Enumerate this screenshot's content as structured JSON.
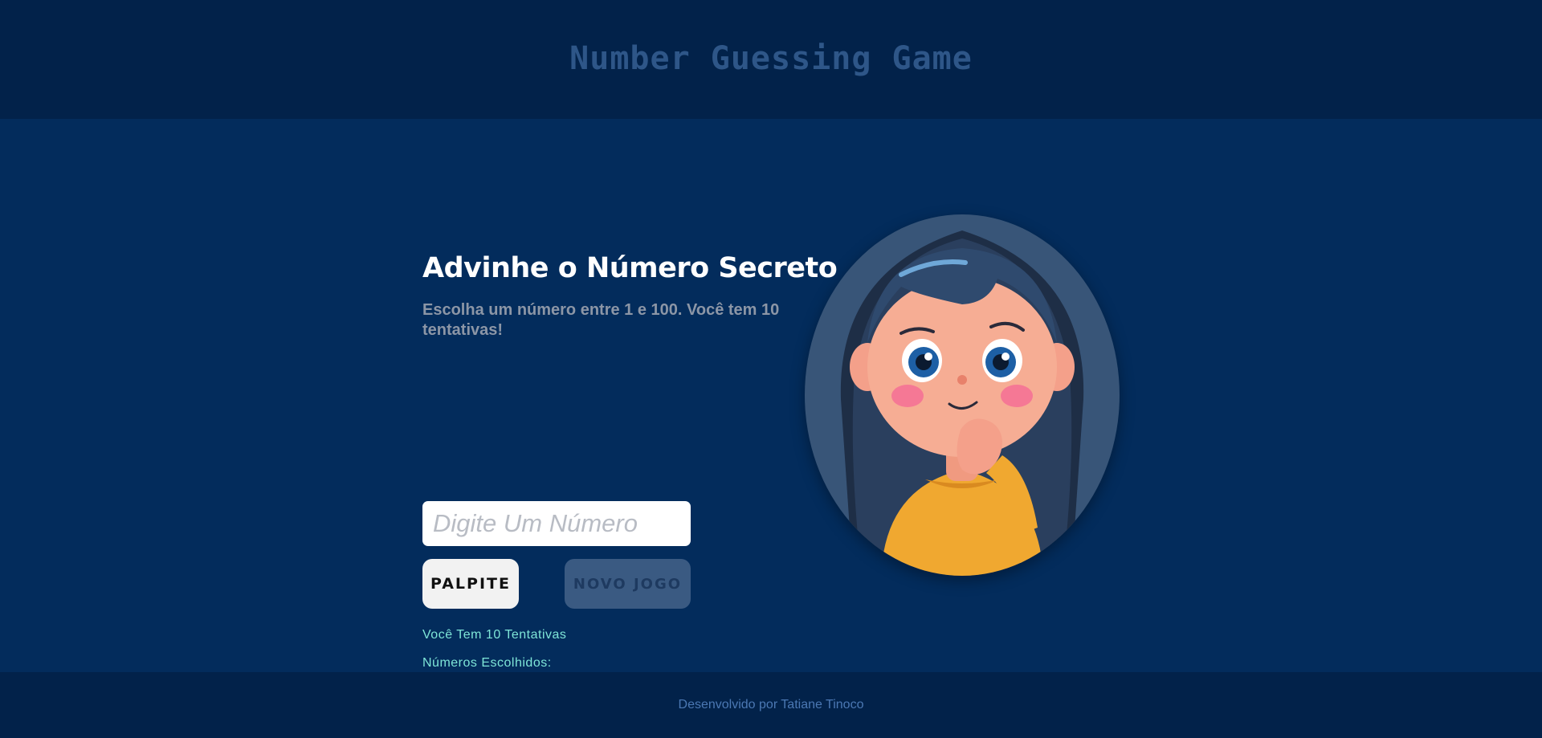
{
  "header": {
    "title": "Number Guessing Game"
  },
  "game": {
    "title": "Advinhe o Número Secreto",
    "description": "Escolha um número entre 1 e 100. Você tem 10 tentativas!",
    "input": {
      "value": "",
      "placeholder": "Digite Um Número"
    },
    "guess_button_label": "PALPITE",
    "new_game_button_label": "NOVO JOGO",
    "attempts_text": "Você Tem 10 Tentativas",
    "chosen_numbers_text": "Números Escolhidos:"
  },
  "illustration": {
    "icon": "thinking-girl-illustration"
  },
  "footer": {
    "text": "Desenvolvido por Tatiane Tinoco"
  },
  "colors": {
    "header_bg": "#02224a",
    "main_bg": "#032c5c",
    "title_text": "#2e5688",
    "status_text": "#7fe6d8",
    "footer_text": "#4b78b3"
  }
}
